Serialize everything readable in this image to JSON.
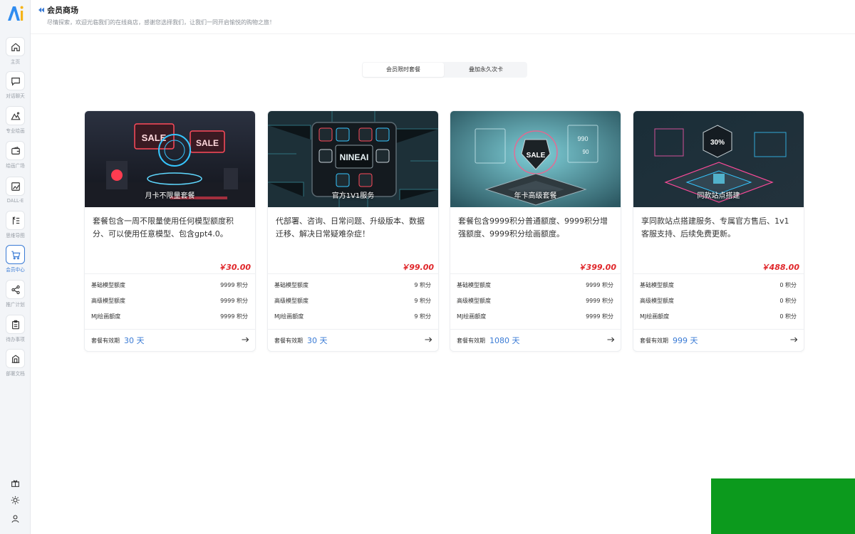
{
  "header": {
    "title": "会员商场",
    "subtitle": "尽情探索，欢迎光临我们的在线商店，感谢您选择我们，让我们一同开启愉悦的购物之旅！"
  },
  "sidebar": {
    "items": [
      {
        "label": "主页",
        "icon": "home-icon"
      },
      {
        "label": "对话聊天",
        "icon": "chat-icon"
      },
      {
        "label": "专业绘画",
        "icon": "mountain-icon"
      },
      {
        "label": "绘画广场",
        "icon": "wallet-icon"
      },
      {
        "label": "DALL-E",
        "icon": "image-edit-icon"
      },
      {
        "label": "思维导图",
        "icon": "mindmap-icon"
      },
      {
        "label": "会员中心",
        "icon": "cart-icon"
      },
      {
        "label": "推广计划",
        "icon": "share-icon"
      },
      {
        "label": "待办事项",
        "icon": "clipboard-icon"
      },
      {
        "label": "部署文档",
        "icon": "building-icon"
      }
    ],
    "active_index": 6,
    "accent_color": "#3a7bd5",
    "bottom_icons": [
      "gift-icon",
      "sun-icon",
      "user-icon"
    ]
  },
  "tabs": [
    {
      "label": "会员限时套餐",
      "active": true
    },
    {
      "label": "叠加永久次卡",
      "active": false
    }
  ],
  "cards": [
    {
      "image_title": "月卡不限量套餐",
      "description": "套餐包含一周不限量使用任何模型额度积分、可以使用任意模型、包含gpt4.0。",
      "price": "￥30.00",
      "rows": [
        {
          "label": "基础模型额度",
          "value": "9999 积分"
        },
        {
          "label": "高级模型额度",
          "value": "9999 积分"
        },
        {
          "label": "MJ绘画额度",
          "value": "9999 积分"
        }
      ],
      "validity_label": "套餐有效期",
      "validity_value": "30 天"
    },
    {
      "image_title": "官方1V1服务",
      "description": "代部署、咨询、日常问题、升级版本、数据迁移、解决日常疑难杂症！",
      "price": "￥99.00",
      "rows": [
        {
          "label": "基础模型额度",
          "value": "9 积分"
        },
        {
          "label": "高级模型额度",
          "value": "9 积分"
        },
        {
          "label": "MJ绘画额度",
          "value": "9 积分"
        }
      ],
      "validity_label": "套餐有效期",
      "validity_value": "30 天"
    },
    {
      "image_title": "年卡高级套餐",
      "description": "套餐包含9999积分普通额度、9999积分增强额度、9999积分绘画额度。",
      "price": "￥399.00",
      "rows": [
        {
          "label": "基础模型额度",
          "value": "9999 积分"
        },
        {
          "label": "高级模型额度",
          "value": "9999 积分"
        },
        {
          "label": "MJ绘画额度",
          "value": "9999 积分"
        }
      ],
      "validity_label": "套餐有效期",
      "validity_value": "1080 天"
    },
    {
      "image_title": "同款站点搭建",
      "description": "享同款站点搭建服务、专属官方售后、1v1客服支持、后续免费更新。",
      "price": "￥488.00",
      "rows": [
        {
          "label": "基础模型额度",
          "value": "0 积分"
        },
        {
          "label": "高级模型额度",
          "value": "0 积分"
        },
        {
          "label": "MJ绘画额度",
          "value": "0 积分"
        }
      ],
      "validity_label": "套餐有效期",
      "validity_value": "999 天"
    }
  ],
  "colors": {
    "price": "#e0262a",
    "validity": "#3a7bd5"
  }
}
